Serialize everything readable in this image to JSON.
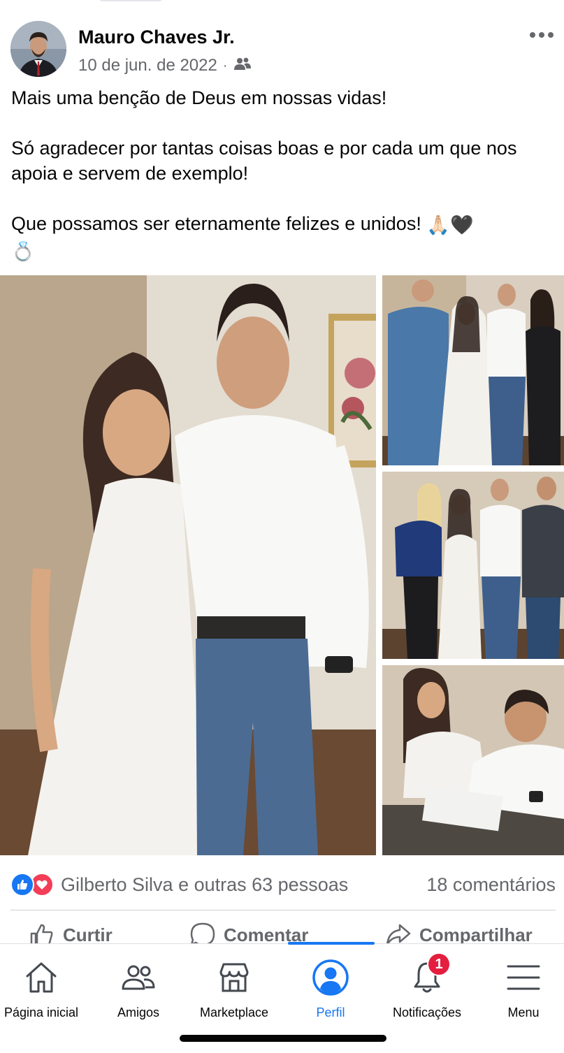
{
  "post": {
    "author": "Mauro Chaves Jr.",
    "date": "10 de jun. de 2022",
    "separator": "·",
    "audience_icon": "friends-audience-icon",
    "more_icon": "more-options-icon",
    "text": {
      "line1": "Mais uma benção de Deus em nossas vidas!",
      "line2": "Só agradecer por tantas coisas boas e por cada um que nos apoia e servem de exemplo!",
      "line3": "Que possamos ser eternamente felizes e unidos!",
      "emojis": [
        "🙏🏻",
        "🖤",
        "💍"
      ]
    },
    "photos": [
      {
        "name": "main-couple-photo"
      },
      {
        "name": "group-photo-1"
      },
      {
        "name": "group-photo-2"
      },
      {
        "name": "signing-photo"
      }
    ]
  },
  "reactions": {
    "summary": "Gilberto Silva e outras 63 pessoas",
    "comments": "18 comentários",
    "icons": [
      "like-reaction-icon",
      "love-reaction-icon"
    ]
  },
  "actions": {
    "like": "Curtir",
    "comment": "Comentar",
    "share": "Compartilhar"
  },
  "nav": {
    "home": "Página inicial",
    "friends": "Amigos",
    "marketplace": "Marketplace",
    "profile": "Perfil",
    "notifications": "Notificações",
    "notifications_badge": "1",
    "menu": "Menu",
    "active": "profile"
  },
  "colors": {
    "accent": "#1877f2",
    "text": "#050505",
    "secondary": "#65676b",
    "badge": "#e41e3f",
    "love": "#f33e58"
  }
}
